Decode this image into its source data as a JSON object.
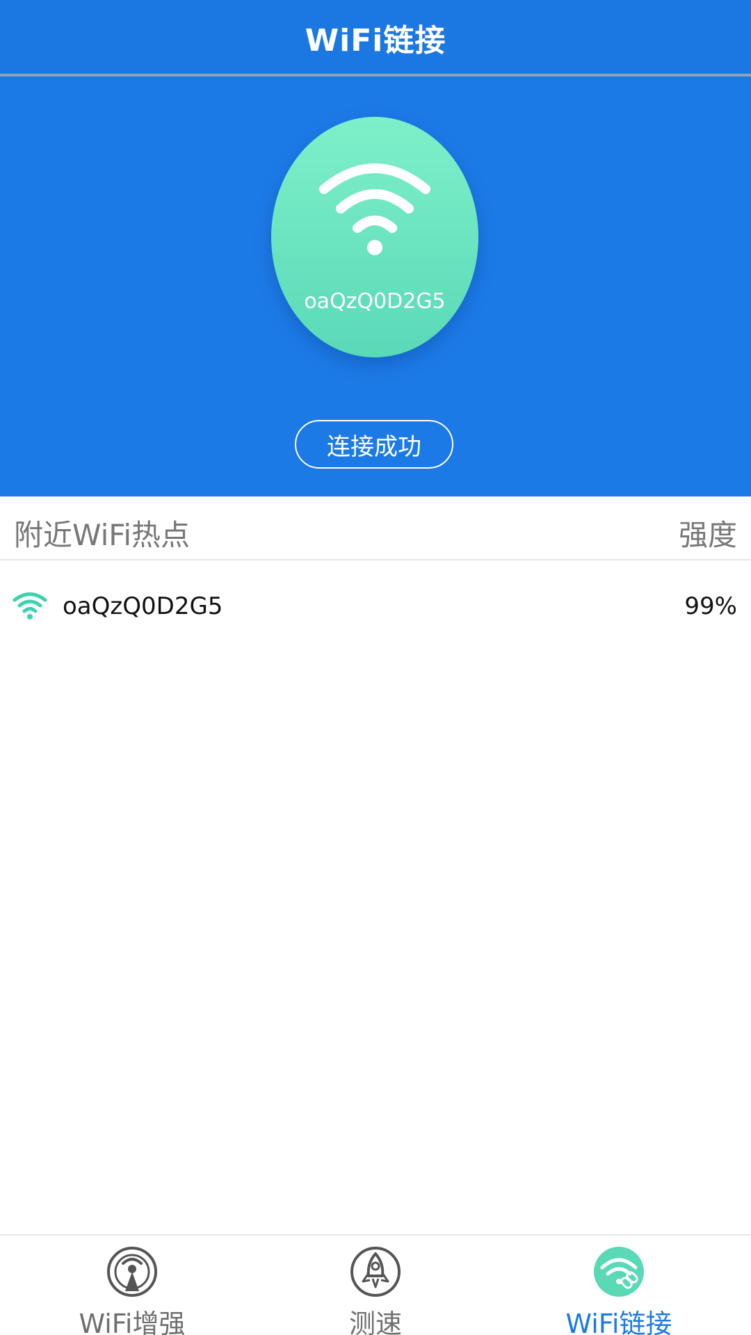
{
  "header": {
    "title": "WiFi链接"
  },
  "current": {
    "ssid": "oaQzQ0D2G5",
    "status": "连接成功",
    "icon": "wifi-icon"
  },
  "list": {
    "header_left": "附近WiFi热点",
    "header_right": "强度",
    "items": [
      {
        "ssid": "oaQzQ0D2G5",
        "strength": "99%",
        "icon": "wifi-icon"
      }
    ]
  },
  "nav": {
    "items": [
      {
        "label": "WiFi增强",
        "icon": "signal-booster-icon",
        "active": false
      },
      {
        "label": "测速",
        "icon": "rocket-icon",
        "active": false
      },
      {
        "label": "WiFi链接",
        "icon": "wifi-link-icon",
        "active": true
      }
    ]
  },
  "colors": {
    "primary": "#1c7ae6",
    "accent": "#5ad9b7",
    "text_muted": "#777777"
  }
}
